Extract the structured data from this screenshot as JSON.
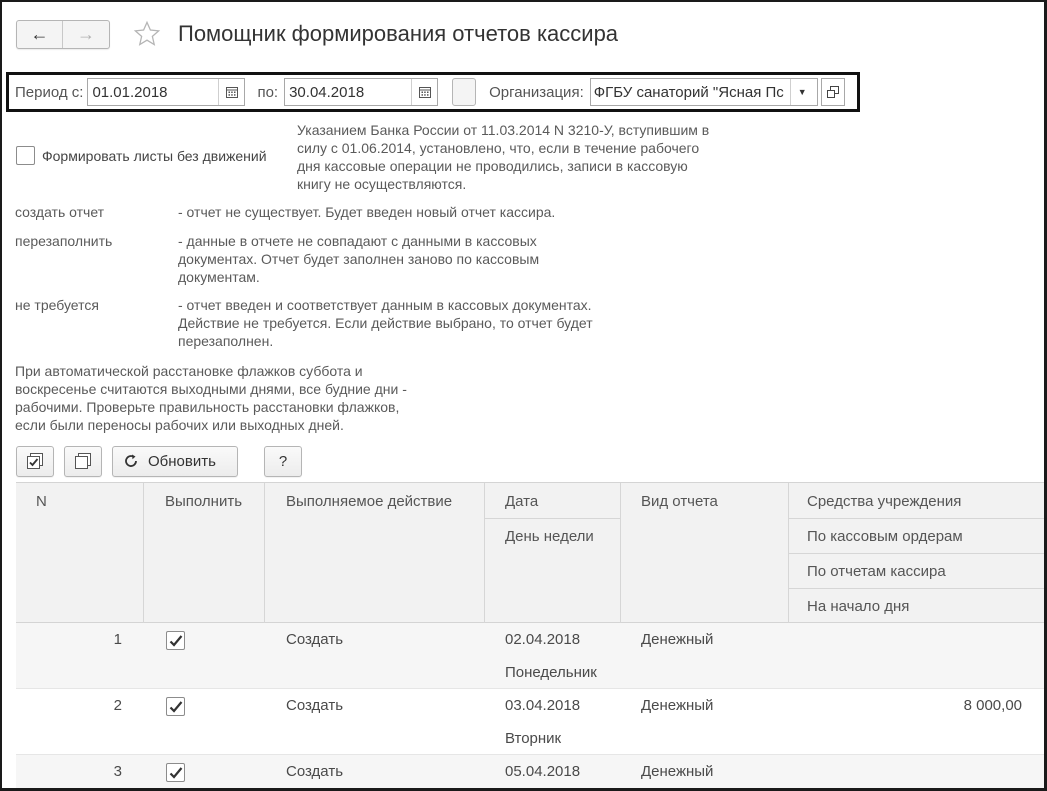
{
  "window": {
    "title": "Помощник формирования отчетов кассира",
    "back_icon": "←",
    "forward_icon": "→"
  },
  "period": {
    "from_label": "Период с:",
    "from_value": "01.01.2018",
    "to_label": "по:",
    "to_value": "30.04.2018",
    "org_label": "Организация:",
    "org_value": "ФГБУ санаторий \"Ясная Пс"
  },
  "options": {
    "empty_sheets_label": "Формировать листы без движений",
    "note_lines": [
      "Указанием Банка России от 11.03.2014 N 3210-У, вступившим в",
      "силу с 01.06.2014, установлено, что, если в течение рабочего",
      "дня кассовые операции не проводились, записи в кассовую",
      "книгу не осуществляются."
    ]
  },
  "definitions": [
    {
      "term": "создать отчет",
      "desc_lines": [
        "- отчет не существует.  Будет введен новый отчет кассира."
      ]
    },
    {
      "term": "перезаполнить",
      "desc_lines": [
        "- данные в отчете не совпадают с данными в кассовых",
        "документах. Отчет будет заполнен заново по кассовым",
        "документам."
      ]
    },
    {
      "term": "не требуется",
      "desc_lines": [
        "- отчет введен и соответствует данным в кассовых документах.",
        "Действие не требуется. Если действие выбрано, то отчет будет",
        "перезаполнен."
      ]
    }
  ],
  "info_lines": [
    "При автоматической расстановке флажков суббота и",
    "воскресенье считаются выходными днями, все будние дни -",
    "рабочими. Проверьте правильность расстановки флажков,",
    "если были переносы рабочих или выходных дней."
  ],
  "toolbar": {
    "refresh_label": "Обновить",
    "help_label": "?"
  },
  "table": {
    "headers": {
      "n": "N",
      "execute": "Выполнить",
      "action": "Выполняемое действие",
      "date": "Дата",
      "weekday": "День недели",
      "report_type": "Вид отчета",
      "funds": "Средства учреждения",
      "by_orders": "По кассовым ордерам",
      "by_reports": "По отчетам кассира",
      "day_start": "На начало дня"
    },
    "rows": [
      {
        "n": "1",
        "checked": true,
        "action": "Создать",
        "date": "02.04.2018",
        "weekday": "Понедельник",
        "report_type": "Денежный",
        "amount": ""
      },
      {
        "n": "2",
        "checked": true,
        "action": "Создать",
        "date": "03.04.2018",
        "weekday": "Вторник",
        "report_type": "Денежный",
        "amount": "8 000,00"
      },
      {
        "n": "3",
        "checked": true,
        "action": "Создать",
        "date": "05.04.2018",
        "weekday": "",
        "report_type": "Денежный",
        "amount": ""
      }
    ]
  }
}
